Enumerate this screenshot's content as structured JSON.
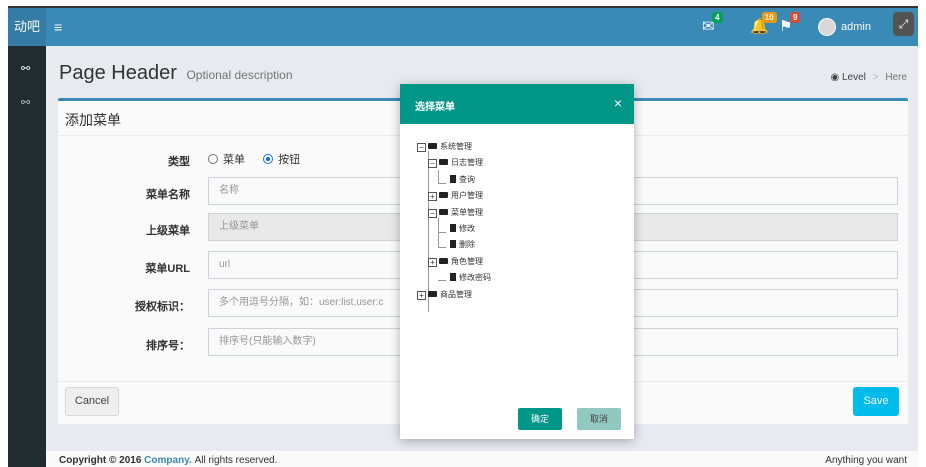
{
  "app": {
    "logo": "动吧",
    "menu_icon": "bars-icon"
  },
  "topbar": {
    "messages_badge": "4",
    "notifications_badge": "10",
    "tasks_badge": "9",
    "user_name": "admin",
    "colors": {
      "bar": "#3c8dbc",
      "badge_green": "#00a65a",
      "badge_yellow": "#f39c12",
      "badge_red": "#dd4b39"
    }
  },
  "page_header": {
    "title": "Page Header",
    "description": "Optional description"
  },
  "breadcrumb": {
    "level": "Level",
    "here": "Here"
  },
  "form": {
    "title": "添加菜单",
    "type_label": "类型",
    "type_options": [
      "菜单",
      "按钮"
    ],
    "type_selected": "按钮",
    "name_label": "菜单名称",
    "name_placeholder": "名称",
    "parent_label": "上级菜单",
    "parent_placeholder": "上级菜单",
    "url_label": "菜单URL",
    "url_placeholder": "url",
    "perm_label": "授权标识：",
    "perm_placeholder": "多个用逗号分隔，如：user:list,user:c",
    "sort_label": "排序号：",
    "sort_placeholder": "排序号(只能输入数字)",
    "cancel": "Cancel",
    "save": "Save"
  },
  "footer": {
    "copyright_prefix": "Copyright © 2016",
    "company": "Company.",
    "rights": "All rights reserved.",
    "right_text": "Anything you want"
  },
  "modal": {
    "title": "选择菜单",
    "close": "×",
    "tree": [
      {
        "label": "系统管理",
        "expander": "−",
        "icon": "folder-open-icon"
      },
      {
        "label": "日志管理",
        "expander": "−",
        "icon": "folder-open-icon"
      },
      {
        "label": "查询",
        "expander": "",
        "icon": "file-icon"
      },
      {
        "label": "用户管理",
        "expander": "+",
        "icon": "folder-icon"
      },
      {
        "label": "菜单管理",
        "expander": "−",
        "icon": "folder-open-icon"
      },
      {
        "label": "修改",
        "expander": "",
        "icon": "file-icon"
      },
      {
        "label": "删除",
        "expander": "",
        "icon": "file-icon"
      },
      {
        "label": "角色管理",
        "expander": "+",
        "icon": "folder-icon"
      },
      {
        "label": "修改密码",
        "expander": "",
        "icon": "file-icon"
      },
      {
        "label": "商品管理",
        "expander": "+",
        "icon": "folder-icon"
      }
    ],
    "confirm": "确定",
    "cancel": "取消",
    "colors": {
      "header": "#009688"
    }
  }
}
